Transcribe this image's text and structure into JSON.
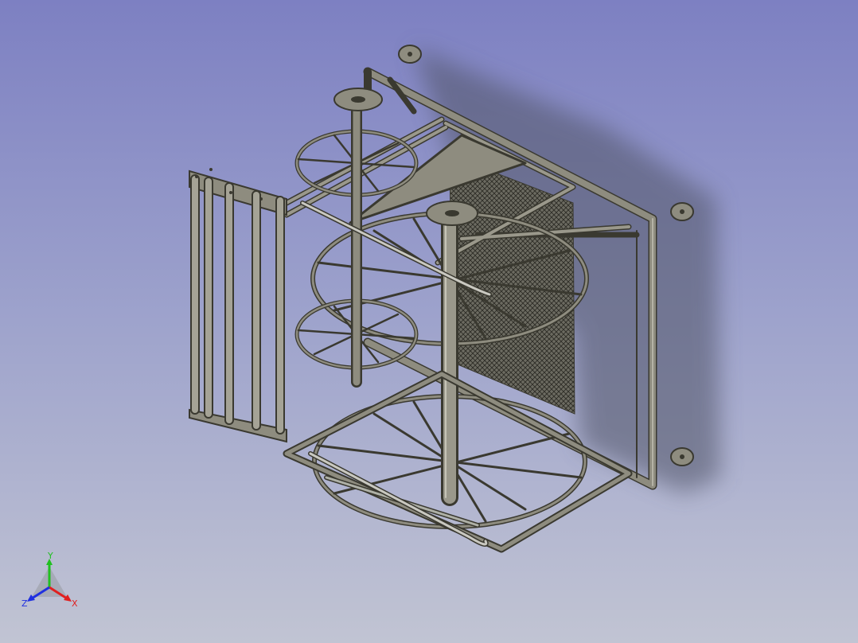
{
  "colors": {
    "background_top": "#7d80c2",
    "background_bottom": "#c1c4d3",
    "metal": "#8e8c7f",
    "metal_dark": "#3a3930",
    "shadow": "#55586a",
    "axis_x": "#e02020",
    "axis_y": "#20c020",
    "axis_z": "#2030e0"
  },
  "axis_triad": {
    "x_label": "X",
    "y_label": "Y",
    "z_label": "Z"
  }
}
